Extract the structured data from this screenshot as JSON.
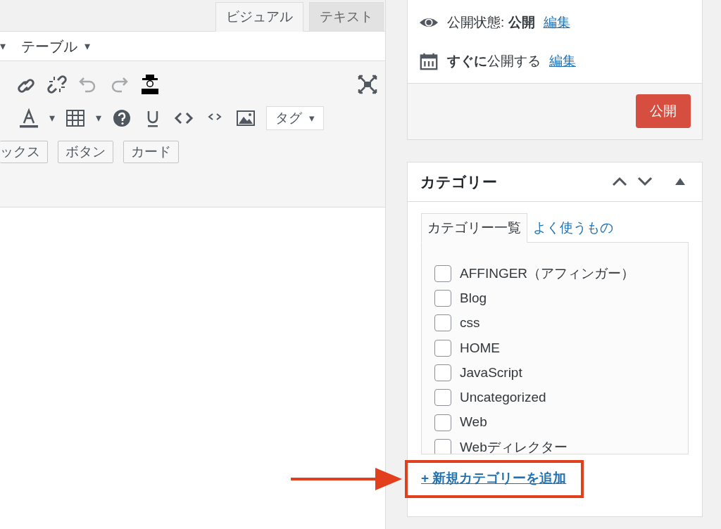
{
  "editor": {
    "tabs": [
      {
        "label": "ビジュアル",
        "selected": true
      },
      {
        "label": "テキスト",
        "selected": false
      }
    ],
    "menus": [
      {
        "caret": "▾"
      },
      {
        "label": "テーブル",
        "caret": "▾"
      }
    ],
    "toolbar_rows": [
      [
        {
          "kind": "link",
          "disabled": false
        },
        {
          "kind": "unlink",
          "disabled": false
        },
        {
          "kind": "undo",
          "disabled": true
        },
        {
          "kind": "redo",
          "disabled": true
        },
        {
          "kind": "person",
          "disabled": false
        },
        {
          "kind": "fullscreen",
          "disabled": false
        }
      ],
      [
        {
          "kind": "textcolor",
          "disabled": false,
          "caret": "▾"
        },
        {
          "kind": "table",
          "disabled": false,
          "caret": "▾"
        },
        {
          "kind": "help",
          "disabled": false
        },
        {
          "kind": "underline",
          "disabled": false
        },
        {
          "kind": "code",
          "disabled": false
        },
        {
          "kind": "codesmall",
          "disabled": false
        },
        {
          "kind": "image",
          "disabled": false
        },
        {
          "kind": "dropdown",
          "label": "タグ",
          "caret": "▾"
        }
      ],
      [
        {
          "kind": "button",
          "label": "ックス"
        },
        {
          "kind": "button",
          "label": "ボタン"
        },
        {
          "kind": "button",
          "label": "カード"
        }
      ]
    ]
  },
  "publish": {
    "rows": [
      {
        "kind": "visibility",
        "text": "公開状態: **公開**",
        "link": "編集"
      },
      {
        "kind": "schedule",
        "text": "**すぐに**公開する",
        "link": "編集"
      }
    ],
    "button": "公開"
  },
  "categories": {
    "title": "カテゴリー",
    "tabs": [
      {
        "label": "カテゴリー一覧",
        "selected": true
      },
      {
        "label": "よく使うもの",
        "selected": false
      }
    ],
    "items": [
      {
        "label": "AFFINGER（アフィンガー）",
        "checked": false
      },
      {
        "label": "Blog",
        "checked": false
      },
      {
        "label": "css",
        "checked": false
      },
      {
        "label": "HOME",
        "checked": false
      },
      {
        "label": "JavaScript",
        "checked": false
      },
      {
        "label": "Uncategorized",
        "checked": false
      },
      {
        "label": "Web",
        "checked": false
      },
      {
        "label": "Webディレクター",
        "checked": false
      }
    ],
    "add_link": "+ 新規カテゴリーを追加"
  }
}
